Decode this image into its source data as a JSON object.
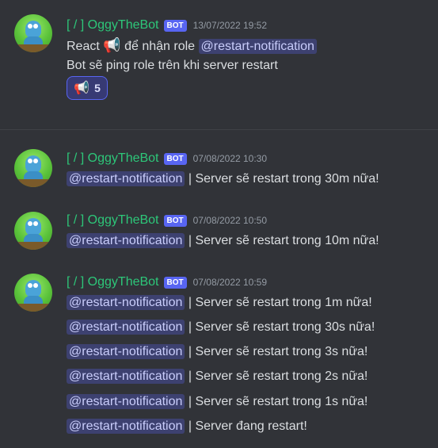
{
  "messages": [
    {
      "username": "[ / ] OggyTheBot",
      "bot_tag": "BOT",
      "timestamp": "13/07/2022 19:52",
      "lines": [
        {
          "before": "React ",
          "emoji": "📢",
          "after": " để nhận role ",
          "mention": "@restart-notification"
        },
        {
          "text": "Bot sẽ ping role trên khi server restart"
        }
      ],
      "reaction": {
        "emoji": "📢",
        "count": "5"
      }
    },
    {
      "username": "[ / ] OggyTheBot",
      "bot_tag": "BOT",
      "timestamp": "07/08/2022 10:30",
      "lines": [
        {
          "mention": "@restart-notification",
          "text": " | Server sẽ restart trong 30m nữa!"
        }
      ]
    },
    {
      "username": "[ / ] OggyTheBot",
      "bot_tag": "BOT",
      "timestamp": "07/08/2022 10:50",
      "lines": [
        {
          "mention": "@restart-notification",
          "text": " | Server sẽ restart trong 10m nữa!"
        }
      ]
    },
    {
      "username": "[ / ] OggyTheBot",
      "bot_tag": "BOT",
      "timestamp": "07/08/2022 10:59",
      "lines": [
        {
          "mention": "@restart-notification",
          "text": " | Server sẽ restart trong 1m nữa!"
        },
        {
          "mention": "@restart-notification",
          "text": " | Server sẽ restart trong 30s nữa!"
        },
        {
          "mention": "@restart-notification",
          "text": " | Server sẽ restart trong 3s nữa!"
        },
        {
          "mention": "@restart-notification",
          "text": " | Server sẽ restart trong 2s nữa!"
        },
        {
          "mention": "@restart-notification",
          "text": " | Server sẽ restart trong 1s nữa!"
        },
        {
          "mention": "@restart-notification",
          "text": " | Server đang restart!"
        }
      ]
    }
  ],
  "colors": {
    "background": "#313338",
    "username": "#2dc779",
    "bot_tag": "#5865f2",
    "mention_bg": "#3c4270",
    "mention_text": "#c9cdfb",
    "timestamp": "#949ba4"
  },
  "icons": {
    "avatar": "oggy-avatar-icon",
    "reaction_emoji": "megaphone-icon"
  }
}
